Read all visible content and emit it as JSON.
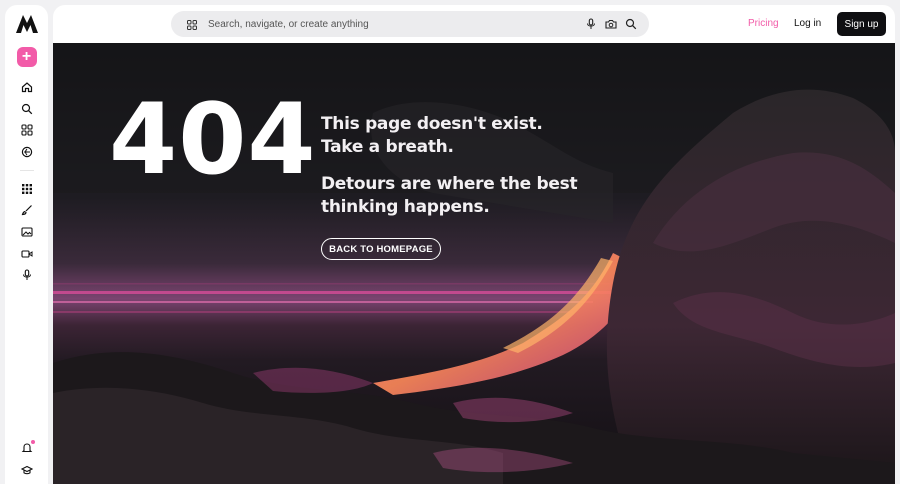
{
  "topbar": {
    "search_placeholder": "Search, navigate, or create anything",
    "pricing_label": "Pricing",
    "login_label": "Log in",
    "signup_label": "Sign up"
  },
  "sidebar": {
    "create_label": "+",
    "items": [
      {
        "icon": "home-icon"
      },
      {
        "icon": "search-icon"
      },
      {
        "icon": "apps-icon"
      },
      {
        "icon": "explore-icon"
      },
      {
        "icon": "grid-icon"
      },
      {
        "icon": "brush-icon"
      },
      {
        "icon": "image-icon"
      },
      {
        "icon": "video-icon"
      },
      {
        "icon": "microphone-icon"
      }
    ],
    "bottom": [
      {
        "icon": "notification-icon"
      },
      {
        "icon": "learn-icon"
      }
    ]
  },
  "hero": {
    "code": "404",
    "message_1": "This page doesn't exist. Take a breath.",
    "message_2": "Detours are where the best thinking happens.",
    "button_label": "BACK TO HOMEPAGE"
  },
  "colors": {
    "accent": "#f25ba8",
    "dark_button": "#0f0f12",
    "lava_pink": "#e64fa0",
    "lava_orange": "#ff9a4a"
  }
}
